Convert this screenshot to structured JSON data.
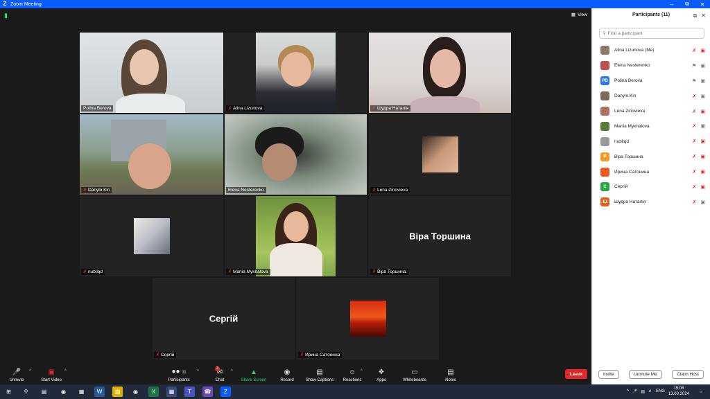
{
  "window": {
    "title": "Zoom Meeting",
    "logo": "Z"
  },
  "stage": {
    "view_label": "View"
  },
  "tiles": [
    {
      "name": "Polina Berova",
      "muted": false,
      "active": true
    },
    {
      "name": "Alina Lizunova",
      "muted": true
    },
    {
      "name": "Шудра Наталія",
      "muted": true
    },
    {
      "name": "Danylo Kin",
      "muted": true
    },
    {
      "name": "Elena Nesterenko",
      "muted": false
    },
    {
      "name": "Lena Zinovieva",
      "muted": true
    },
    {
      "name": "nubilqd",
      "muted": true
    },
    {
      "name": "Mariia Mykhalova",
      "muted": true
    },
    {
      "name": "Віра Торшина",
      "muted": true,
      "big_name": "Віра Торшина"
    },
    {
      "name": "Сергій",
      "muted": true,
      "big_name": "Сергій"
    },
    {
      "name": "Ирина Сатонина",
      "muted": true
    }
  ],
  "toolbar": {
    "unmute": "Unmute",
    "start_video": "Start Video",
    "participants": "Participants",
    "participants_count": "11",
    "chat": "Chat",
    "chat_badge": "3",
    "share_screen": "Share Screen",
    "record": "Record",
    "captions": "Show Captions",
    "reactions": "Reactions",
    "apps": "Apps",
    "whiteboards": "Whiteboards",
    "notes": "Notes",
    "leave": "Leave",
    "share_color": "#23d36b",
    "leave_color": "#e02828"
  },
  "panel": {
    "title": "Participants (11)",
    "search_placeholder": "Find a participant",
    "participants": [
      {
        "name": "Alina Lizunova (Me)",
        "initials": "",
        "color": "#8a7a6a",
        "mic": "muted",
        "video": "off"
      },
      {
        "name": "Elena Nesterenko",
        "initials": "",
        "color": "#c0504d",
        "mic": "on",
        "video": "on"
      },
      {
        "name": "Polina Berova",
        "initials": "PB",
        "color": "#2d7ae0",
        "mic": "on",
        "video": "on"
      },
      {
        "name": "Danylo Kin",
        "initials": "",
        "color": "#7c6a5a",
        "mic": "muted",
        "video": "on"
      },
      {
        "name": "Lena Zinovieva",
        "initials": "",
        "color": "#b07060",
        "mic": "muted",
        "video": "off"
      },
      {
        "name": "Mariia Mykhalova",
        "initials": "",
        "color": "#5a7a3a",
        "mic": "muted",
        "video": "on"
      },
      {
        "name": "nubilqd",
        "initials": "",
        "color": "#9a9a9a",
        "mic": "muted",
        "video": "off"
      },
      {
        "name": "Віра Торшина",
        "initials": "В",
        "color": "#f59b24",
        "mic": "muted",
        "video": "off"
      },
      {
        "name": "Ирина Сатонина",
        "initials": "",
        "color": "#e85a1e",
        "mic": "muted",
        "video": "off"
      },
      {
        "name": "Сергій",
        "initials": "С",
        "color": "#27a844",
        "mic": "muted",
        "video": "off"
      },
      {
        "name": "Шудра Наталія",
        "initials": "Ш",
        "color": "#d9661f",
        "mic": "muted",
        "video": "on"
      }
    ],
    "invite": "Invite",
    "unmute_me": "Unmute Me",
    "claim_host": "Claim Host"
  },
  "taskbar": {
    "lang": "ENG",
    "time": "15:06",
    "date": "13.03.2024"
  }
}
